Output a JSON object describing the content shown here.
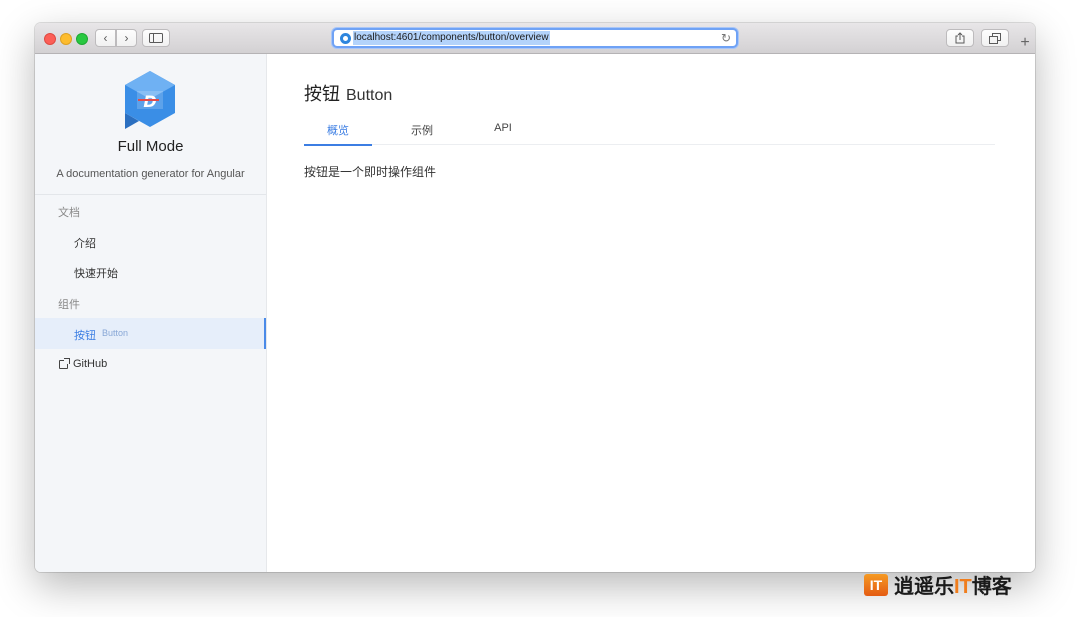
{
  "browser": {
    "url": "localhost:4601/components/button/overview",
    "back_glyph": "‹",
    "forward_glyph": "›",
    "reload_glyph": "↻",
    "new_tab_glyph": "+"
  },
  "sidebar": {
    "brand_name": "Full Mode",
    "brand_description": "A documentation generator for Angular",
    "groups": [
      {
        "title": "文档",
        "items": [
          {
            "label": "介绍"
          },
          {
            "label": "快速开始"
          }
        ]
      },
      {
        "title": "组件",
        "items": [
          {
            "label": "按钮",
            "sub": "Button",
            "active": true
          }
        ]
      }
    ],
    "github_label": "GitHub"
  },
  "main": {
    "title": "按钮",
    "title_en": "Button",
    "tabs": [
      {
        "label": "概览",
        "active": true
      },
      {
        "label": "示例",
        "active": false
      },
      {
        "label": "API",
        "active": false
      }
    ],
    "content": "按钮是一个即时操作组件"
  },
  "watermark": {
    "logo": "IT",
    "text_before": "逍遥乐",
    "text_it": "IT",
    "text_after": "博客"
  },
  "colors": {
    "accent": "#3c7ee3",
    "sidebar_bg": "#f4f6f9",
    "active_item_bg": "#e6eefa",
    "logo_blue": "#3a8ee6",
    "watermark_orange": "#f07d1c"
  }
}
